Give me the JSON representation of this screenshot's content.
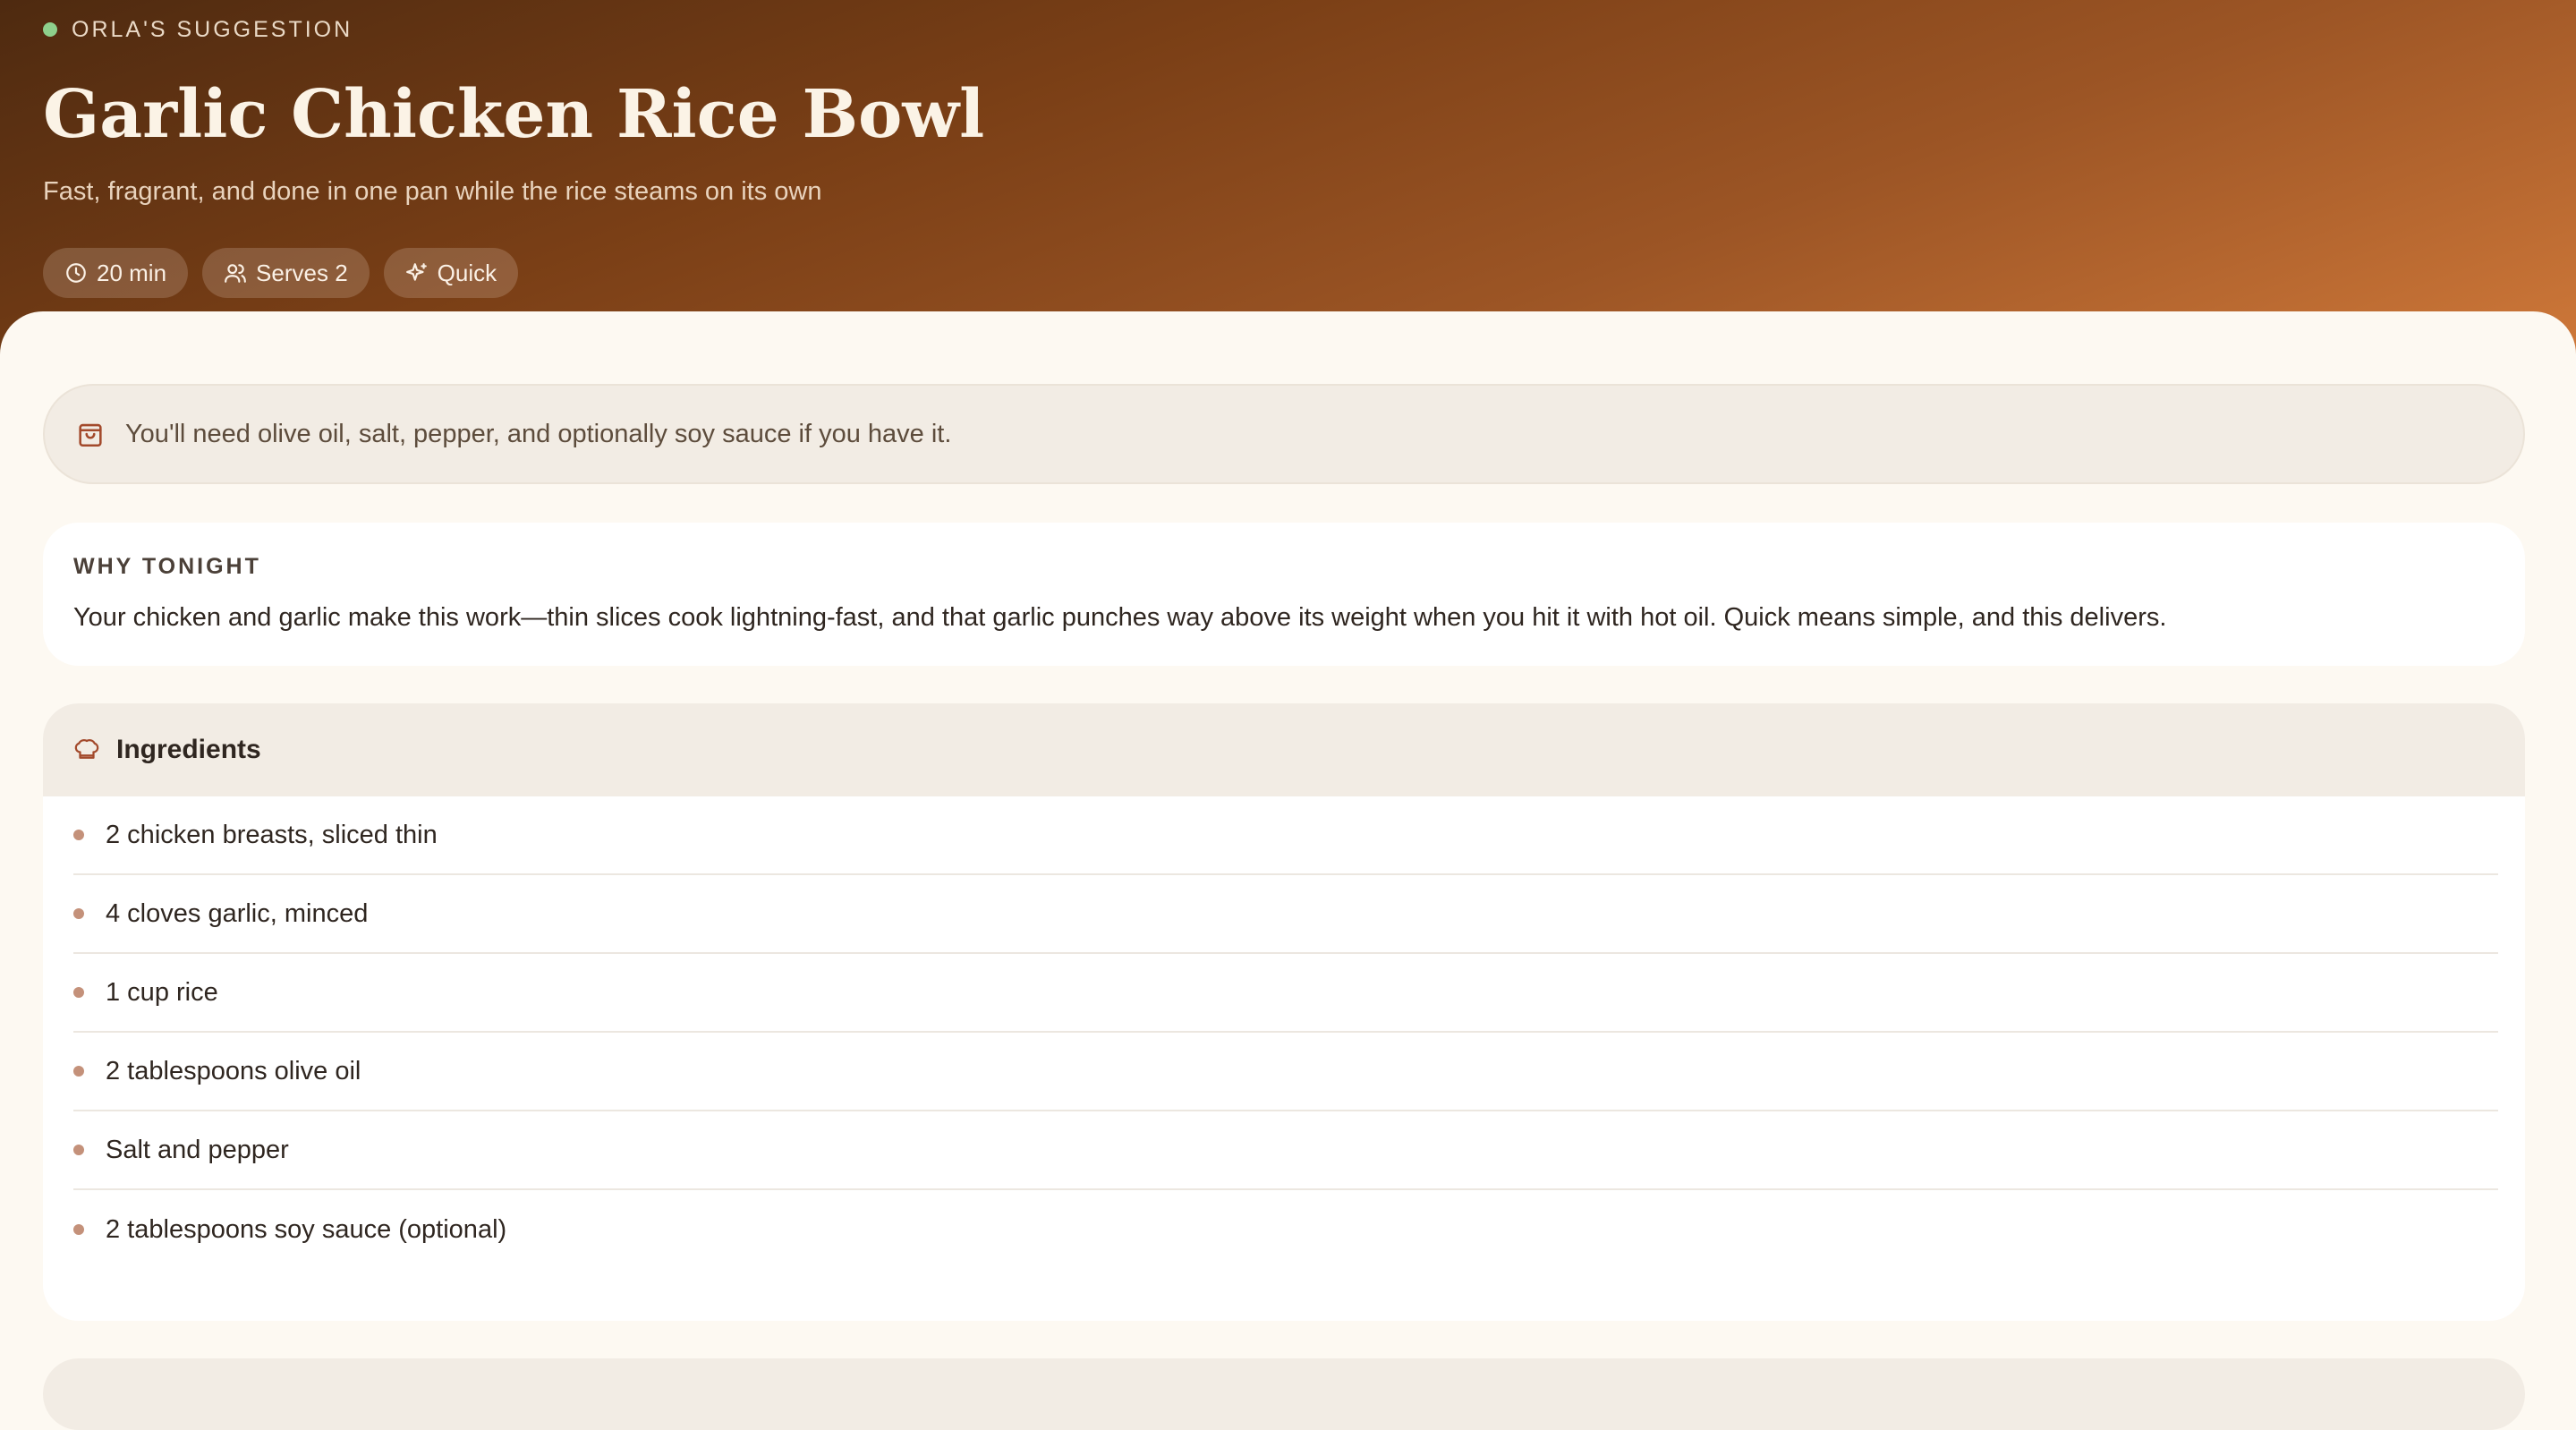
{
  "hero": {
    "eyebrow": "ORLA'S SUGGESTION",
    "title": "Garlic Chicken Rice Bowl",
    "subtitle": "Fast, fragrant, and done in one pan while the rice steams on its own",
    "pills": [
      {
        "icon": "clock-icon",
        "label": "20 min"
      },
      {
        "icon": "users-icon",
        "label": "Serves 2"
      },
      {
        "icon": "sparkle-icon",
        "label": "Quick"
      }
    ],
    "status_dot_color": "#8ed08c"
  },
  "pantry_note": {
    "icon": "shopping-bag-icon",
    "text": "You'll need olive oil, salt, pepper, and optionally soy sauce if you have it."
  },
  "why_tonight": {
    "title": "WHY TONIGHT",
    "text": "Your chicken and garlic make this work—thin slices cook lightning-fast, and that garlic punches way above its weight when you hit it with hot oil. Quick means simple, and this delivers."
  },
  "ingredients": {
    "icon": "chef-hat-icon",
    "title": "Ingredients",
    "items": [
      "2 chicken breasts, sliced thin",
      "4 cloves garlic, minced",
      "1 cup rice",
      "2 tablespoons olive oil",
      "Salt and pepper",
      "2 tablespoons soy sauce (optional)"
    ]
  },
  "colors": {
    "hero_start": "#4e2a10",
    "hero_end": "#d0793a",
    "bullet": "#c4917a",
    "page_bg": "#fdf9f2"
  }
}
